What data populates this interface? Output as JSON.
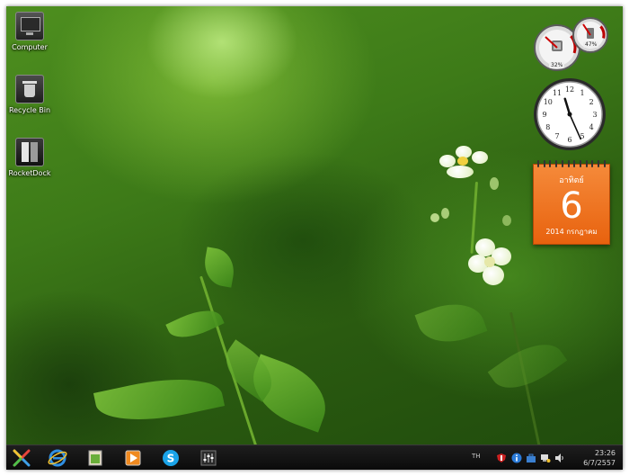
{
  "desktop": {
    "icons": [
      {
        "label": "Computer"
      },
      {
        "label": "Recycle Bin"
      },
      {
        "label": "RocketDock"
      }
    ]
  },
  "gadgets": {
    "meter": {
      "cpu_label": "32%",
      "memory_label": "47%",
      "cpu_value": 32,
      "memory_value": 47
    },
    "clock": {
      "hour": 11,
      "minute": 26,
      "numerals": [
        "12",
        "1",
        "2",
        "3",
        "4",
        "5",
        "6",
        "7",
        "8",
        "9",
        "10",
        "11"
      ]
    },
    "calendar": {
      "weekday": "อาทิตย์",
      "day": "6",
      "year_month": "2014 กรกฎาคม"
    }
  },
  "taskbar": {
    "apps": [
      {
        "name": "start-icon"
      },
      {
        "name": "internet-explorer-icon"
      },
      {
        "name": "file-explorer-icon"
      },
      {
        "name": "media-player-icon"
      },
      {
        "name": "skype-icon"
      },
      {
        "name": "mixer-icon"
      }
    ],
    "language": "TH",
    "time": "23:26",
    "date": "6/7/2557"
  },
  "colors": {
    "accent_orange": "#e8620e",
    "taskbar": "#111111"
  }
}
